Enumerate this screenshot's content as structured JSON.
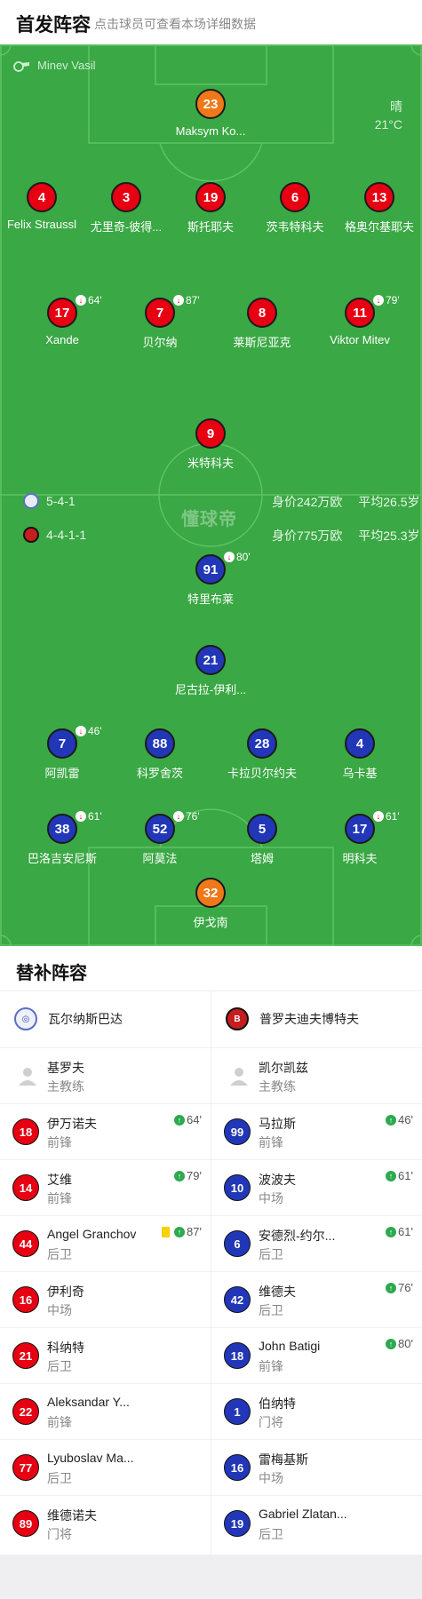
{
  "header": {
    "title": "首发阵容",
    "subtitle": "点击球员可查看本场详细数据"
  },
  "pitch": {
    "referee": "Minev Vasil",
    "weather": "晴",
    "temperature": "21°C",
    "watermark": "懂球帝",
    "home_team": {
      "formation": "5-4-1",
      "value": "身价242万欧",
      "avg_age": "平均26.5岁"
    },
    "away_team": {
      "formation": "4-4-1-1",
      "value": "身价775万欧",
      "avg_age": "平均25.3岁"
    },
    "home_players": [
      {
        "num": "23",
        "name": "Maksym Ko...",
        "gk": true
      },
      {
        "num": "4",
        "name": "Felix Straussl"
      },
      {
        "num": "3",
        "name": "尤里奇-彼得..."
      },
      {
        "num": "19",
        "name": "斯托耶夫"
      },
      {
        "num": "6",
        "name": "茨韦特科夫"
      },
      {
        "num": "13",
        "name": "格奥尔基耶夫"
      },
      {
        "num": "17",
        "name": "Xande",
        "sub": "64'",
        "goal": true
      },
      {
        "num": "7",
        "name": "贝尔纳",
        "sub": "87'",
        "goal": true
      },
      {
        "num": "8",
        "name": "莱斯尼亚克"
      },
      {
        "num": "11",
        "name": "Viktor Mitev",
        "sub": "79'"
      },
      {
        "num": "9",
        "name": "米特科夫"
      }
    ],
    "away_players": [
      {
        "num": "91",
        "name": "特里布莱",
        "sub": "80'"
      },
      {
        "num": "21",
        "name": "尼古拉-伊利..."
      },
      {
        "num": "7",
        "name": "阿凯雷",
        "sub": "46'"
      },
      {
        "num": "88",
        "name": "科罗舍茨",
        "yellow": true
      },
      {
        "num": "28",
        "name": "卡拉贝尔约夫"
      },
      {
        "num": "4",
        "name": "乌卡基",
        "goal": true
      },
      {
        "num": "38",
        "name": "巴洛吉安尼斯",
        "sub": "61'"
      },
      {
        "num": "52",
        "name": "阿莫法",
        "sub": "76'"
      },
      {
        "num": "5",
        "name": "塔姆"
      },
      {
        "num": "17",
        "name": "明科夫",
        "sub": "61'"
      },
      {
        "num": "32",
        "name": "伊戈南",
        "gk": true
      }
    ]
  },
  "subs": {
    "title": "替补阵容",
    "home": {
      "team_name": "瓦尔纳斯巴达",
      "coach": {
        "name": "基罗夫",
        "role": "主教练"
      },
      "players": [
        {
          "num": "18",
          "name": "伊万诺夫",
          "pos": "前锋",
          "time": "64'"
        },
        {
          "num": "14",
          "name": "艾维",
          "pos": "前锋",
          "time": "79'"
        },
        {
          "num": "44",
          "name": "Angel Granchov",
          "pos": "后卫",
          "time": "87'",
          "yellow": true
        },
        {
          "num": "16",
          "name": "伊利奇",
          "pos": "中场"
        },
        {
          "num": "21",
          "name": "科纳特",
          "pos": "后卫"
        },
        {
          "num": "22",
          "name": "Aleksandar Y...",
          "pos": "前锋"
        },
        {
          "num": "77",
          "name": "Lyuboslav Ma...",
          "pos": "后卫"
        },
        {
          "num": "89",
          "name": "维德诺夫",
          "pos": "门将"
        }
      ]
    },
    "away": {
      "team_name": "普罗夫迪夫博特夫",
      "coach": {
        "name": "凯尔凯兹",
        "role": "主教练"
      },
      "players": [
        {
          "num": "99",
          "name": "马拉斯",
          "pos": "前锋",
          "time": "46'"
        },
        {
          "num": "10",
          "name": "波波夫",
          "pos": "中场",
          "time": "61'"
        },
        {
          "num": "6",
          "name": "安德烈-约尔...",
          "pos": "后卫",
          "time": "61'"
        },
        {
          "num": "42",
          "name": "维德夫",
          "pos": "后卫",
          "time": "76'"
        },
        {
          "num": "18",
          "name": "John Batigi",
          "pos": "前锋",
          "time": "80'"
        },
        {
          "num": "1",
          "name": "伯纳特",
          "pos": "门将"
        },
        {
          "num": "16",
          "name": "雷梅基斯",
          "pos": "中场"
        },
        {
          "num": "19",
          "name": "Gabriel Zlatan...",
          "pos": "后卫"
        }
      ]
    }
  }
}
